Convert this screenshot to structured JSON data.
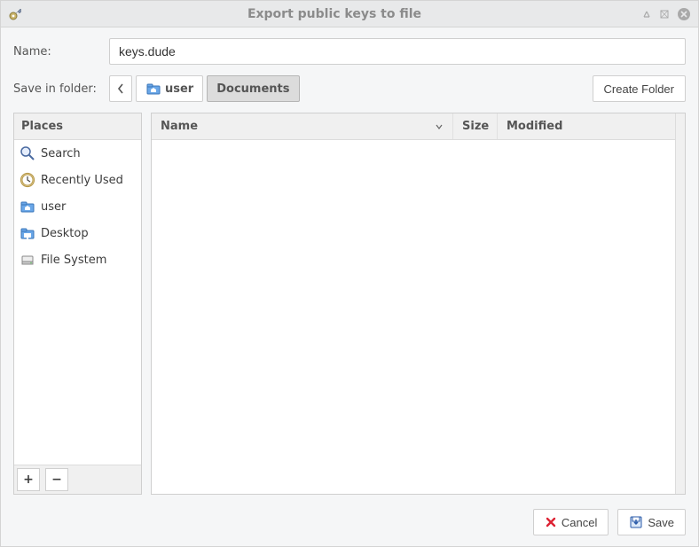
{
  "window": {
    "title": "Export public keys to file"
  },
  "name_row": {
    "label": "Name:",
    "value": "keys.dude"
  },
  "folder_row": {
    "label": "Save in folder:",
    "segments": [
      {
        "label": "user",
        "icon": "home-folder-icon"
      },
      {
        "label": "Documents",
        "active": true
      }
    ],
    "create_folder_label": "Create Folder"
  },
  "places": {
    "header": "Places",
    "items": [
      {
        "label": "Search",
        "icon": "search-icon"
      },
      {
        "label": "Recently Used",
        "icon": "clock-icon"
      },
      {
        "label": "user",
        "icon": "home-folder-icon"
      },
      {
        "label": "Desktop",
        "icon": "desktop-icon"
      },
      {
        "label": "File System",
        "icon": "drive-icon"
      }
    ],
    "add_label": "+",
    "remove_label": "−"
  },
  "columns": {
    "name": "Name",
    "size": "Size",
    "modified": "Modified"
  },
  "footer": {
    "cancel": "Cancel",
    "save": "Save"
  }
}
